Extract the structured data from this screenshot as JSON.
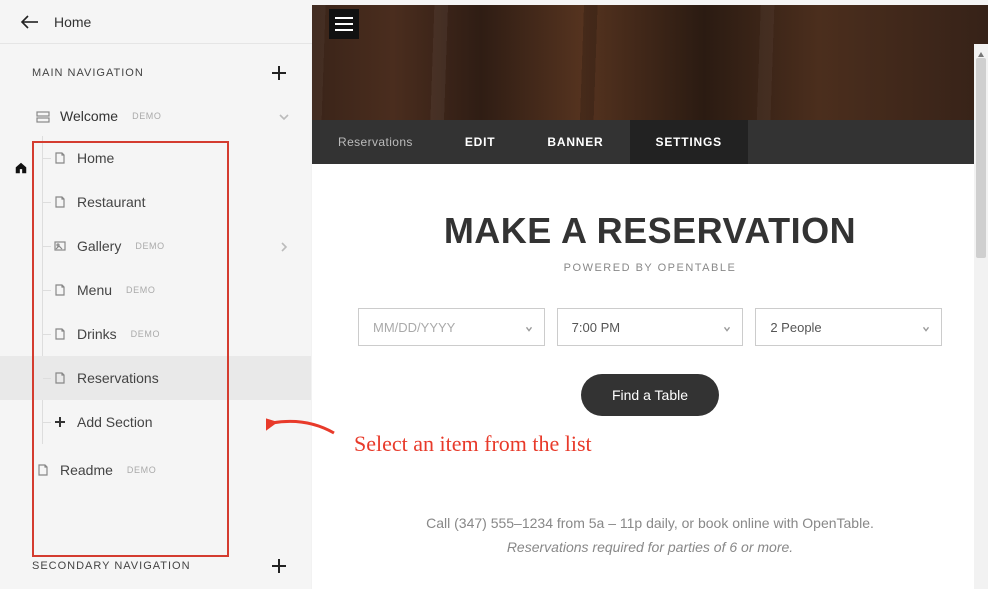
{
  "topbar": {
    "home_label": "Home"
  },
  "sidebar": {
    "main_nav_title": "MAIN NAVIGATION",
    "welcome_label": "Welcome",
    "children": {
      "home": "Home",
      "restaurant": "Restaurant",
      "gallery": "Gallery",
      "menu": "Menu",
      "drinks": "Drinks",
      "reservations": "Reservations",
      "add_section": "Add Section"
    },
    "readme_label": "Readme",
    "secondary_title": "SECONDARY NAVIGATION",
    "demo_tag": "DEMO"
  },
  "preview": {
    "tabs": {
      "title": "Reservations",
      "edit": "EDIT",
      "banner": "BANNER",
      "settings": "SETTINGS"
    },
    "heading": "MAKE A RESERVATION",
    "powered": "POWERED BY OPENTABLE",
    "date_placeholder": "MM/DD/YYYY",
    "time_value": "7:00 PM",
    "people_value": "2 People",
    "find_table": "Find a Table",
    "footer_line1": "Call (347) 555–1234 from 5a – 11p daily, or book online with OpenTable.",
    "footer_line2": "Reservations required for parties of 6 or more."
  },
  "annotation": "Select an item from the list"
}
